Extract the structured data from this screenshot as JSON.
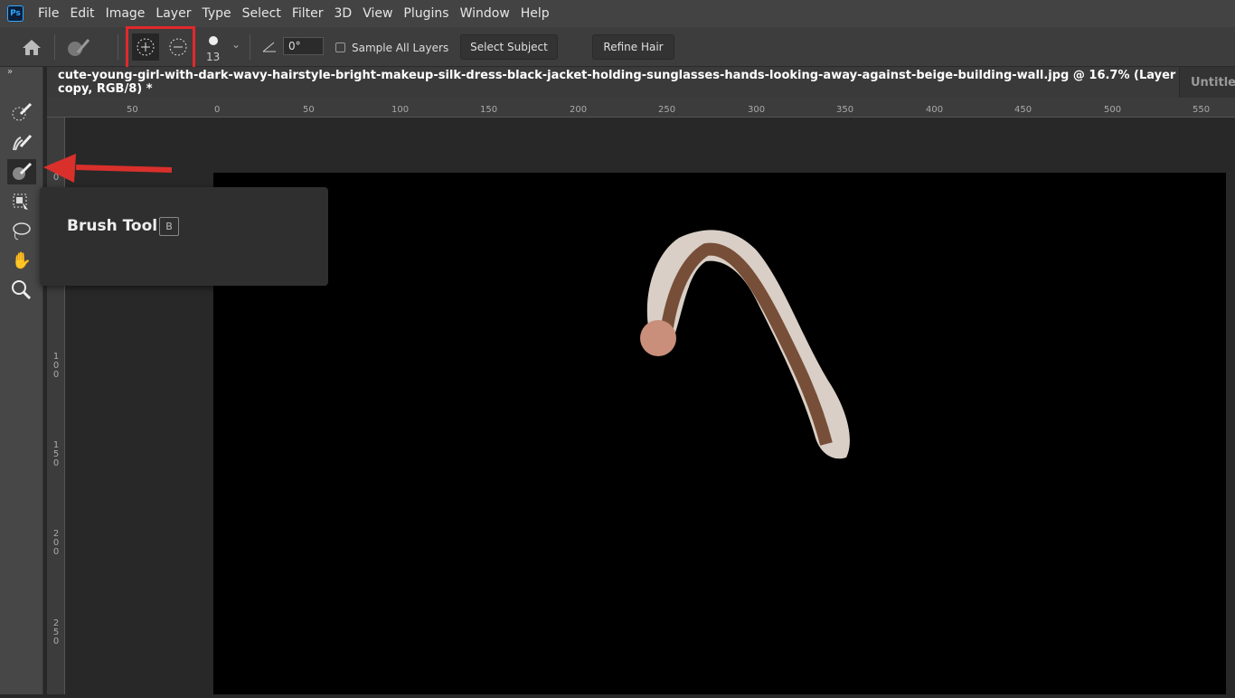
{
  "menu": {
    "logo": "Ps",
    "items": [
      "File",
      "Edit",
      "Image",
      "Layer",
      "Type",
      "Select",
      "Filter",
      "3D",
      "View",
      "Plugins",
      "Window",
      "Help"
    ]
  },
  "options": {
    "brush_size": "13",
    "angle": "0°",
    "sample_all_layers": "Sample All Layers",
    "sample_checked": false,
    "select_subject": "Select Subject",
    "refine_hair": "Refine Hair"
  },
  "tabs": [
    {
      "label": "cute-young-girl-with-dark-wavy-hairstyle-bright-makeup-silk-dress-black-jacket-holding-sunglasses-hands-looking-away-against-beige-building-wall.jpg @ 16.7% (Layer 0 copy, RGB/8) *",
      "active": true
    },
    {
      "label": "Untitled",
      "active": false
    }
  ],
  "ruler": {
    "h": [
      "50",
      "0",
      "50",
      "100",
      "150",
      "200",
      "250",
      "300",
      "350",
      "400",
      "450",
      "500",
      "550"
    ],
    "v": [
      "0",
      "100",
      "150",
      "200",
      "250"
    ]
  },
  "tooltip": {
    "title": "Brush Tool",
    "shortcut": "B"
  },
  "colors": {
    "highlight": "#e0282b",
    "arrow": "#d9302c"
  }
}
